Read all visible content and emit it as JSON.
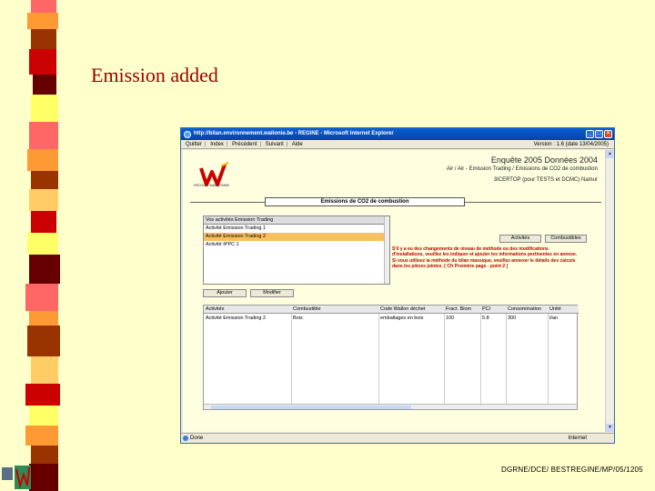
{
  "slide": {
    "title": "Emission added",
    "footer_ref": "DGRNE/DCE/ BESTREGINE/MP/05/1205"
  },
  "window": {
    "title": "http://bilan.environnement.wallonie.be - REGINE - Microsoft Internet Explorer",
    "menu": [
      "Quitter",
      "Index",
      "Précédent",
      "Suivant",
      "Aide"
    ],
    "version": "Version : 1.6 (date 13/04/2005)",
    "status": "Done",
    "zone": "Internet"
  },
  "header": {
    "logo_caption": "RÉGION WALLONNE",
    "line1": "Enquête 2005 Données 2004",
    "line2": "Air / Air - Emission Trading / Emissions de CO2 de combustion",
    "line3": "3ICERTOP (pour TESTS et DCMC) Namur"
  },
  "section_title": "Emissions de CO2 de combustion",
  "activity_list": {
    "header": "Vos activités Emission Trading",
    "items": [
      "Activité Emission Trading 1",
      "Activité Emission Trading 2",
      "Activité IPPC 1"
    ],
    "selected_index": 1
  },
  "buttons": {
    "activities": "Activités",
    "fuels": "Combustibles",
    "add": "Ajouter",
    "modify": "Modifier"
  },
  "warning_text": "S'il y a eu des changements de niveau de méthode ou des modifications d'installations, veuillez les indiquer et ajouter les informations pertinentes en annexe. Si vous utilisez la méthode du bilan massique, veuillez annexer le détails des calculs dans les pièces jointes. [ Cfr Première page - point 2 ]",
  "table": {
    "columns": [
      "Activités",
      "Combustible",
      "Code Wallon déchet",
      "Fract. Biom",
      "PCI",
      "Consommation",
      "Unité"
    ],
    "rows": [
      [
        "Activité Emission Trading 2",
        "Bois",
        "emballages en bois",
        "100",
        "5.8",
        "300",
        "t/an"
      ]
    ]
  },
  "colors": {
    "slide_bg": "#ffffcc",
    "title": "#990000",
    "warning": "#c00000",
    "selected_row": "#f6c060"
  }
}
